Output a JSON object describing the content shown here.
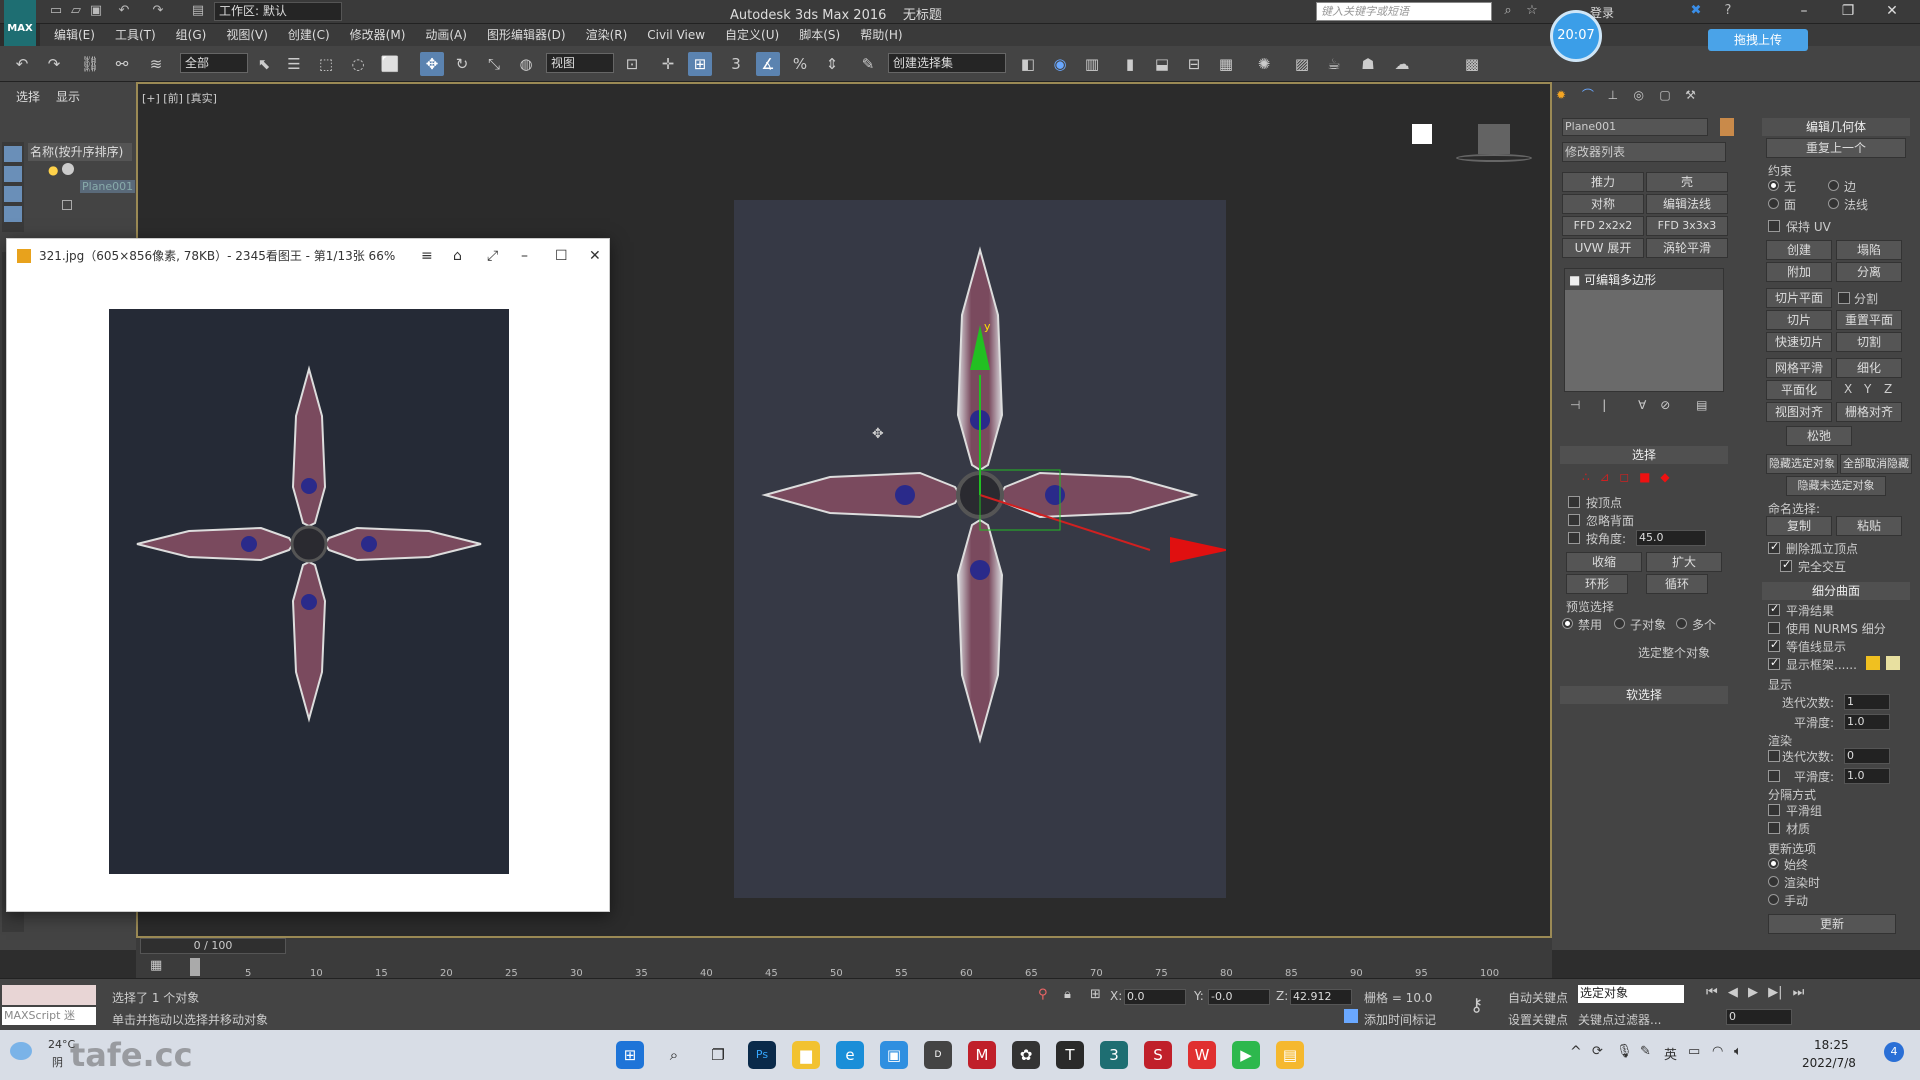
{
  "app": {
    "logo": "MAX",
    "title": "Autodesk 3ds Max 2016",
    "doc_title": "无标题",
    "workspace": "工作区: 默认",
    "search_placeholder": "键入关键字或短语",
    "login": "登录",
    "clock": "20:07",
    "upload_btn": "拖拽上传"
  },
  "menu": [
    "编辑(E)",
    "工具(T)",
    "组(G)",
    "视图(V)",
    "创建(C)",
    "修改器(M)",
    "动画(A)",
    "图形编辑器(D)",
    "渲染(R)",
    "Civil View",
    "自定义(U)",
    "脚本(S)",
    "帮助(H)"
  ],
  "toolbar": {
    "filter": "全部",
    "ref_coord": "视图",
    "named_sel": "创建选择集"
  },
  "scene_explorer": {
    "tabs": [
      "选择",
      "显示"
    ],
    "header": "名称(按升序排序)",
    "object": "Plane001"
  },
  "viewport": {
    "label": "[+] [前] [真实]",
    "gizmo_y": "y"
  },
  "viewer": {
    "title": "321.jpg（605×856像素, 78KB）- 2345看图王 - 第1/13张 66%",
    "menu_icon": "≡",
    "pin_icon": "⌂",
    "full_icon": "⤢",
    "min_icon": "–",
    "max_icon": "☐",
    "close_icon": "✕"
  },
  "command_panel": {
    "object_name": "Plane001",
    "modifier_list": "修改器列表",
    "buttons": [
      [
        "推力",
        "壳"
      ],
      [
        "对称",
        "编辑法线"
      ],
      [
        "FFD 2x2x2",
        "FFD 3x3x3"
      ],
      [
        "UVW 展开",
        "涡轮平滑"
      ]
    ],
    "stack_item": "可编辑多边形",
    "selection_header": "选择",
    "sel_checks": [
      "按顶点",
      "忽略背面",
      "按角度:"
    ],
    "angle_val": "45.0",
    "shrink": "收缩",
    "grow": "扩大",
    "ring": "环形",
    "loop": "循环",
    "preview_sel": "预览选择",
    "preview_opts": [
      "禁用",
      "子对象",
      "多个"
    ],
    "select_whole": "选定整个对象",
    "soft_sel": "软选择"
  },
  "edit_geometry": {
    "header": "编辑几何体",
    "repeat_last": "重复上一个",
    "constraints": "约束",
    "c_opts": [
      "无",
      "边",
      "面",
      "法线"
    ],
    "preserve_uv": "保持 UV",
    "create": "创建",
    "collapse": "塌陷",
    "attach": "附加",
    "detach": "分离",
    "slice_plane": "切片平面",
    "split": "分割",
    "slice": "切片",
    "reset_plane": "重置平面",
    "quickslice": "快速切片",
    "cut": "切割",
    "meshsmooth": "网格平滑",
    "tessellate": "细化",
    "planarize": "平面化",
    "xyz": [
      "X",
      "Y",
      "Z"
    ],
    "view_align": "视图对齐",
    "grid_align": "栅格对齐",
    "relax": "松弛",
    "hide_sel": "隐藏选定对象",
    "unhide_all": "全部取消隐藏",
    "hide_unsel": "隐藏未选定对象",
    "named_sel": "命名选择:",
    "copy": "复制",
    "paste": "粘贴",
    "delete_iso": "删除孤立顶点",
    "full_interact": "完全交互",
    "subdiv_header": "细分曲面",
    "smooth_result": "平滑结果",
    "use_nurms": "使用 NURMS 细分",
    "isoline": "等值线显示",
    "show_cage": "显示框架......",
    "display": "显示",
    "iterations": "迭代次数:",
    "iter_val": "1",
    "smoothness": "平滑度:",
    "smooth_val": "1.0",
    "render": "渲染",
    "r_iter_val": "0",
    "r_smooth_val": "1.0",
    "sep_by": "分隔方式",
    "smooth_groups": "平滑组",
    "materials": "材质",
    "update_opts": "更新选项",
    "always": "始终",
    "when_render": "渲染时",
    "manual": "手动",
    "update": "更新",
    "cage_color1": "#f0c020",
    "cage_color2": "#e8e0a0"
  },
  "timeline": {
    "slider": "0 / 100",
    "ticks": [
      "5",
      "10",
      "15",
      "20",
      "25",
      "30",
      "35",
      "40",
      "45",
      "50",
      "55",
      "60",
      "65",
      "70",
      "75",
      "80",
      "85",
      "90",
      "95",
      "100"
    ]
  },
  "status": {
    "maxscript": "MAXScript 迷",
    "selected": "选择了 1 个对象",
    "prompt": "单击并拖动以选择并移动对象",
    "x_label": "X:",
    "x": "0.0",
    "y_label": "Y:",
    "y": "-0.0",
    "z_label": "Z:",
    "z": "42.912",
    "grid": "栅格 = 10.0",
    "autokey": "自动关键点",
    "setkey": "设置关键点",
    "sel_obj": "选定对象",
    "key_filter": "关键点过滤器...",
    "add_time_tag": "添加时间标记",
    "frame": "0"
  },
  "taskbar": {
    "weather": "24°C",
    "weather2": "阴",
    "time": "18:25",
    "date": "2022/7/8",
    "ime": "英",
    "notif": "4",
    "watermark": "tafe.cc"
  }
}
